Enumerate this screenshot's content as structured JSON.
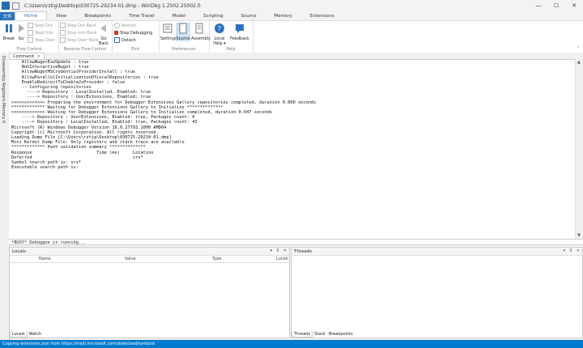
{
  "window": {
    "title": "C:\\Users\\rztig\\Desktop\\030725-29234-01.dmp - WinDbg 1.2502.25002.0",
    "controls": {
      "minimize": "—",
      "maximize": "☐",
      "close": "✕"
    }
  },
  "menu": {
    "file": "文件",
    "tabs": [
      {
        "label": "Home"
      },
      {
        "label": "View"
      },
      {
        "label": "Breakpoints"
      },
      {
        "label": "Time Travel"
      },
      {
        "label": "Model"
      },
      {
        "label": "Scripting"
      },
      {
        "label": "Source"
      },
      {
        "label": "Memory"
      },
      {
        "label": "Extensions"
      }
    ]
  },
  "ribbon": {
    "flow_control": {
      "label": "Flow Control",
      "break": "Break",
      "go": "Go",
      "step_out": "Step Out",
      "step_into": "Step Into",
      "step_over": "Step Over"
    },
    "reverse_flow": {
      "label": "Reverse Flow Control",
      "step_out_back": "Step Out Back",
      "step_into_back": "Step Into Back",
      "step_over_back": "Step Over Back",
      "go_back": "Go Back"
    },
    "end": {
      "label": "End",
      "restart": "Restart",
      "stop": "Stop Debugging",
      "detach": "Detach"
    },
    "preferences": {
      "label": "Preferences",
      "settings": "Settings",
      "source": "Source",
      "assembly": "Assembly"
    },
    "help": {
      "label": "Help",
      "local_help": "Local Help ▾",
      "feedback": "Feedback"
    }
  },
  "left_strip": "Disassembly  Registers  Memory 0",
  "command": {
    "tab_label": "Command",
    "tab_close": "✕",
    "lines": [
      "    AllowNugetExeUpdate : true",
      "    NonInteractiveNuget : true",
      "    AllowNugetMSCredentialProviderInstall : true",
      "    AllowParallelInitializationOfLocalRepositories : true",
      "    EnableRedirectToChakraJsProvider : false",
      "",
      "    -- Configuring repositories",
      "      ----> Repository : LocalInstalled, Enabled: true",
      "      ----> Repository : UserExtensions, Enabled: true",
      "",
      ">>>>>>>>>>>>> Preparing the environment for Debugger Extensions Gallery repositories completed, duration 0.000 seconds",
      "",
      "************* Waiting for Debugger Extensions Gallery to Initialize **************",
      "",
      ">>>>>>>>>>>>> Waiting for Debugger Extensions Gallery to Initialize completed, duration 0.047 seconds",
      "    ----> Repository : UserExtensions, Enabled: true, Packages count: 0",
      "    ----> Repository : LocalInstalled, Enabled: true, Packages count: 43",
      "",
      "Microsoft (R) Windows Debugger Version 10.0.27793.1000 AMD64",
      "Copyright (c) Microsoft Corporation. All rights reserved.",
      "",
      "",
      "Loading Dump File [C:\\Users\\rztig\\Desktop\\030725-29234-01.dmp]",
      "Mini Kernel Dump File: Only registers and stack trace are available",
      "",
      "",
      "************* Path validation summary **************",
      "Response                         Time (ms)     Location",
      "Deferred                                       srv*",
      "Symbol search path is: srv*",
      "Executable search path is:"
    ],
    "input": "*BUSY* Debuggee is running..."
  },
  "locals": {
    "title": "Locals",
    "columns": [
      "Name",
      "Value",
      "Type",
      "Locati"
    ],
    "tabs": [
      {
        "label": "Locals"
      },
      {
        "label": "Watch"
      }
    ]
  },
  "threads": {
    "title": "Threads",
    "tabs": [
      {
        "label": "Threads"
      },
      {
        "label": "Stack"
      },
      {
        "label": "Breakpoints"
      }
    ]
  },
  "pane_controls": {
    "dropdown": "▾",
    "pin": "⊼",
    "close": "✕"
  },
  "status": {
    "text": "Copying extension.json from https://msdl.microsoft.com/download/symbols"
  },
  "colors": {
    "accent": "#2b72c2",
    "status_bar": "#007acc",
    "stop_red": "#d9342b"
  }
}
